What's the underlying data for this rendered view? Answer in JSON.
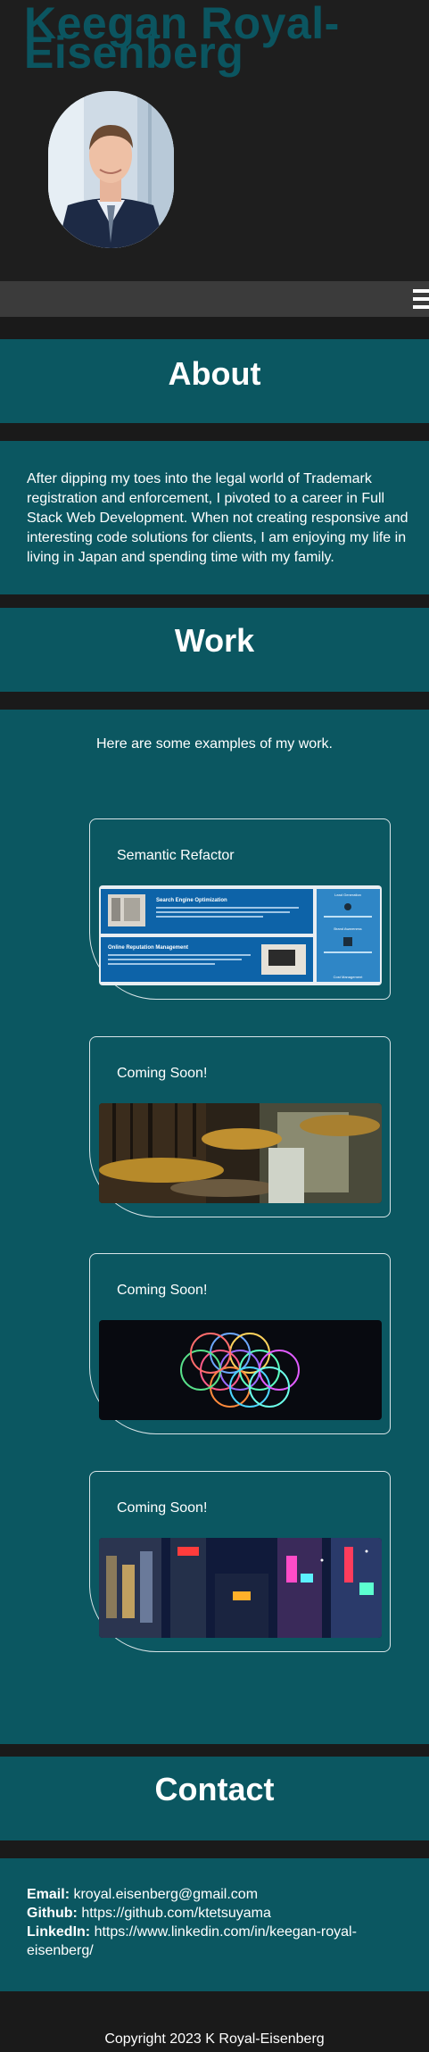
{
  "header": {
    "site_title": "Keegan Royal-Eisenberg"
  },
  "about": {
    "heading": "About",
    "body": "After dipping my toes into the legal world of Trademark registration and enforcement, I pivoted to a career in Full Stack Web Development. When not creating responsive and interesting code solutions for clients, I am enjoying my life in living in Japan and spending time with my family."
  },
  "work": {
    "heading": "Work",
    "intro": "Here are some examples of my work.",
    "projects": [
      {
        "title": "Semantic Refactor",
        "thumb_texts": [
          "Search Engine Optimization",
          "Online Reputation Management",
          "Lead Generation",
          "Brand Awareness",
          "Cost Management"
        ]
      },
      {
        "title": "Coming Soon!"
      },
      {
        "title": "Coming Soon!"
      },
      {
        "title": "Coming Soon!"
      }
    ]
  },
  "contact": {
    "heading": "Contact",
    "email_label": "Email:",
    "email": "kroyal.eisenberg@gmail.com",
    "github_label": "Github:",
    "github": "https://github.com/ktetsuyama",
    "linkedin_label": "LinkedIn:",
    "linkedin": "https://www.linkedin.com/in/keegan-royal-eisenberg/"
  },
  "footer": {
    "copyright": "Copyright 2023 K Royal-Eisenberg"
  },
  "colors": {
    "teal": "#0b5761",
    "title_teal": "#0b5560",
    "header_bg": "#1e1e1e",
    "nav_bg": "#3b3b3b",
    "separator": "#141414"
  },
  "icons": {
    "menu": "hamburger-menu-icon"
  }
}
